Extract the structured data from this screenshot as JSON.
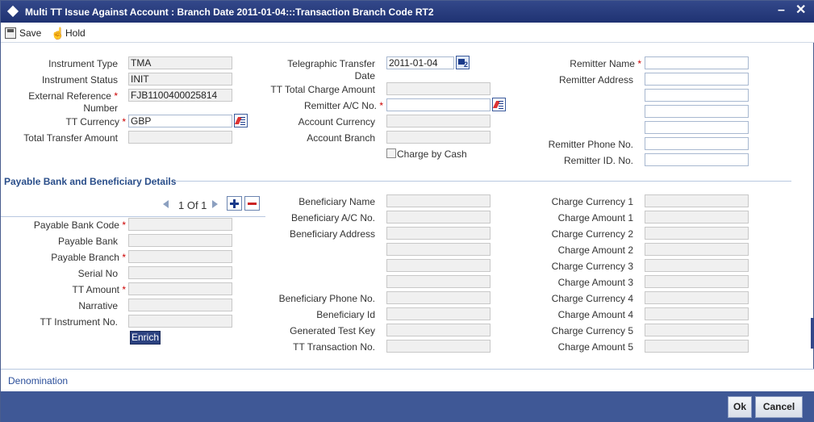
{
  "window": {
    "title": "Multi TT Issue Against Account : Branch Date 2011-01-04:::Transaction Branch Code RT2"
  },
  "toolbar": {
    "save_label": "Save",
    "hold_label": "Hold"
  },
  "main": {
    "instrument_type": {
      "label": "Instrument Type",
      "value": "TMA"
    },
    "instrument_status": {
      "label": "Instrument Status",
      "value": "INIT"
    },
    "external_reference": {
      "label": "External Reference",
      "label2": "Number",
      "value": "FJB1100400025814"
    },
    "tt_currency": {
      "label": "TT Currency",
      "value": "GBP"
    },
    "total_transfer_amount": {
      "label": "Total Transfer Amount",
      "value": ""
    },
    "telegraphic_transfer_date": {
      "label": "Telegraphic Transfer",
      "label2": "Date",
      "value": "2011-01-04"
    },
    "tt_total_charge_amount": {
      "label": "TT Total Charge Amount",
      "value": ""
    },
    "remitter_ac_no": {
      "label": "Remitter A/C No.",
      "value": ""
    },
    "account_currency": {
      "label": "Account Currency",
      "value": ""
    },
    "account_branch": {
      "label": "Account Branch",
      "value": ""
    },
    "charge_by_cash": {
      "label": "Charge by Cash"
    },
    "remitter_name": {
      "label": "Remitter Name",
      "value": ""
    },
    "remitter_address": {
      "label": "Remitter Address",
      "lines": [
        "",
        "",
        "",
        ""
      ]
    },
    "remitter_phone": {
      "label": "Remitter Phone No.",
      "value": ""
    },
    "remitter_id": {
      "label": "Remitter ID. No.",
      "value": ""
    }
  },
  "payable_section": {
    "title": "Payable Bank and Beneficiary Details",
    "pager": {
      "text": "1 Of 1"
    },
    "payable_bank_code": {
      "label": "Payable Bank Code",
      "value": ""
    },
    "payable_bank": {
      "label": "Payable Bank",
      "value": ""
    },
    "payable_branch": {
      "label": "Payable Branch",
      "value": ""
    },
    "serial_no": {
      "label": "Serial No",
      "value": ""
    },
    "tt_amount": {
      "label": "TT Amount",
      "value": ""
    },
    "narrative": {
      "label": "Narrative",
      "value": ""
    },
    "tt_instrument_no": {
      "label": "TT Instrument No.",
      "value": ""
    },
    "enrich_label": "Enrich",
    "beneficiary_name": {
      "label": "Beneficiary Name",
      "value": ""
    },
    "beneficiary_ac_no": {
      "label": "Beneficiary A/C No.",
      "value": ""
    },
    "beneficiary_address": {
      "label": "Beneficiary Address",
      "lines": [
        "",
        "",
        "",
        ""
      ]
    },
    "beneficiary_phone": {
      "label": "Beneficiary Phone No.",
      "value": ""
    },
    "beneficiary_id": {
      "label": "Beneficiary Id",
      "value": ""
    },
    "generated_test_key": {
      "label": "Generated Test Key",
      "value": ""
    },
    "tt_transaction_no": {
      "label": "TT Transaction No.",
      "value": ""
    },
    "charges": [
      {
        "label": "Charge Currency 1",
        "value": ""
      },
      {
        "label": "Charge Amount 1",
        "value": ""
      },
      {
        "label": "Charge Currency 2",
        "value": ""
      },
      {
        "label": "Charge Amount 2",
        "value": ""
      },
      {
        "label": "Charge Currency 3",
        "value": ""
      },
      {
        "label": "Charge Amount 3",
        "value": ""
      },
      {
        "label": "Charge Currency 4",
        "value": ""
      },
      {
        "label": "Charge Amount 4",
        "value": ""
      },
      {
        "label": "Charge Currency 5",
        "value": ""
      },
      {
        "label": "Charge Amount 5",
        "value": ""
      }
    ]
  },
  "bottom": {
    "denomination_label": "Denomination"
  },
  "footer": {
    "ok_label": "Ok",
    "cancel_label": "Cancel"
  },
  "icons": {
    "save": "save-icon",
    "hold": "hold-icon",
    "lov": "list-of-values-icon",
    "calendar": "calendar-icon"
  },
  "colors": {
    "titlebar": "#1f3272",
    "footer": "#3f5896",
    "section_title": "#2a4e8a",
    "required": "#cc0000"
  }
}
